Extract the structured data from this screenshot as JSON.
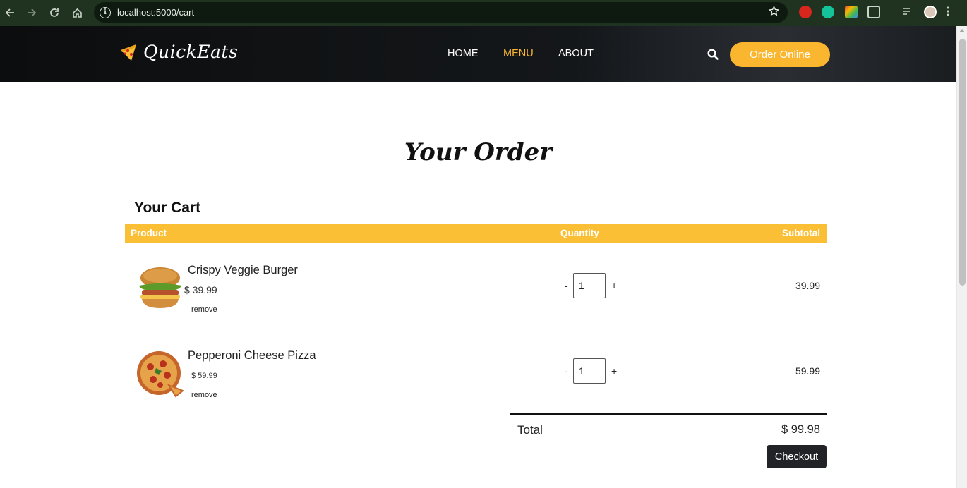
{
  "browser": {
    "url": "localhost:5000/cart"
  },
  "header": {
    "logo_text": "QuickEats",
    "nav": [
      {
        "label": "HOME",
        "active": false
      },
      {
        "label": "MENU",
        "active": true
      },
      {
        "label": "ABOUT",
        "active": false
      }
    ],
    "order_button": "Order Online",
    "accent_color": "#fab62e"
  },
  "main": {
    "page_title": "Your Order",
    "cart_heading": "Your Cart",
    "columns": {
      "product": "Product",
      "quantity": "Quantity",
      "subtotal": "Subtotal"
    },
    "items": [
      {
        "name": "Crispy Veggie Burger",
        "price": "$ 39.99",
        "remove_label": "remove",
        "quantity": "1",
        "minus": "-",
        "plus": "+",
        "subtotal": "39.99",
        "icon": "burger-image"
      },
      {
        "name": "Pepperoni Cheese Pizza",
        "price": "$ 59.99",
        "remove_label": "remove",
        "quantity": "1",
        "minus": "-",
        "plus": "+",
        "subtotal": "59.99",
        "icon": "pizza-image"
      }
    ],
    "total_label": "Total",
    "total_value": "$ 99.98",
    "checkout_label": "Checkout"
  }
}
